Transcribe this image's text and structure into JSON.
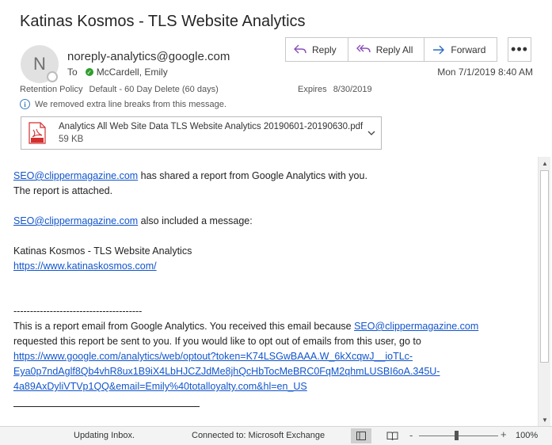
{
  "email": {
    "subject": "Katinas Kosmos - TLS Website Analytics",
    "avatar_initial": "N",
    "sender": "noreply-analytics@google.com",
    "to_label": "To",
    "recipient": "McCardell, Emily",
    "retention_label": "Retention Policy",
    "retention_value": "Default - 60 Day Delete (60 days)",
    "expires_label": "Expires",
    "expires_value": "8/30/2019",
    "info_message": "We removed extra line breaks from this message.",
    "date": "Mon 7/1/2019 8:40 AM"
  },
  "toolbar": {
    "reply": "Reply",
    "reply_all": "Reply All",
    "forward": "Forward",
    "more": "•••"
  },
  "attachment": {
    "file_name": "Analytics All Web Site Data TLS Website Analytics 20190601-20190630.pdf",
    "file_size": "59 KB",
    "icon_label": "PDF"
  },
  "body": {
    "line1_link": "SEO@clippermagazine.com",
    "line1_text": " has shared a report from Google Analytics with you.",
    "line2": "The report is attached.",
    "line3_link": "SEO@clippermagazine.com",
    "line3_text": " also included a message:",
    "line4": "Katinas Kosmos - TLS Website Analytics",
    "line5_link": "https://www.katinaskosmos.com/",
    "separator": "---------------------------------------",
    "para_text1": "This is a report email from Google Analytics. You received this email because ",
    "para_link1": "SEO@clippermagazine.com",
    "para_text2": "requested this report be sent to you. If you would like to opt out of emails from this user, go to",
    "optout_line1": "https://www.google.com/analytics/web/optout?token=K74LSGwBAAA.W_6kXcqwJ__ioTLc-",
    "optout_line2": "Eya0p7ndAglf8Qb4vhR8ux1B9iX4LbHJCZJdMe8jhQcHbTocMeBRC0FqM2qhmLUSBI6oA.345U-",
    "optout_line3": "4a89AxDyliVTVp1QQ&email=Emily%40totalloyalty.com&hl=en_US"
  },
  "statusbar": {
    "updating": "Updating Inbox.",
    "connected": "Connected to: Microsoft Exchange",
    "zoom_minus": "-",
    "zoom_plus": "+",
    "zoom_level": "100%",
    "zoom_fraction": 0.47
  },
  "scrollbar": {
    "up_arrow": "▲",
    "down_arrow": "▼"
  },
  "colors": {
    "link": "#1155cc",
    "pdf_red": "#d32f2f",
    "presence_green": "#2e9e2e",
    "accent_purple": "#8a4fb8",
    "forward_blue": "#2b6cc4"
  }
}
